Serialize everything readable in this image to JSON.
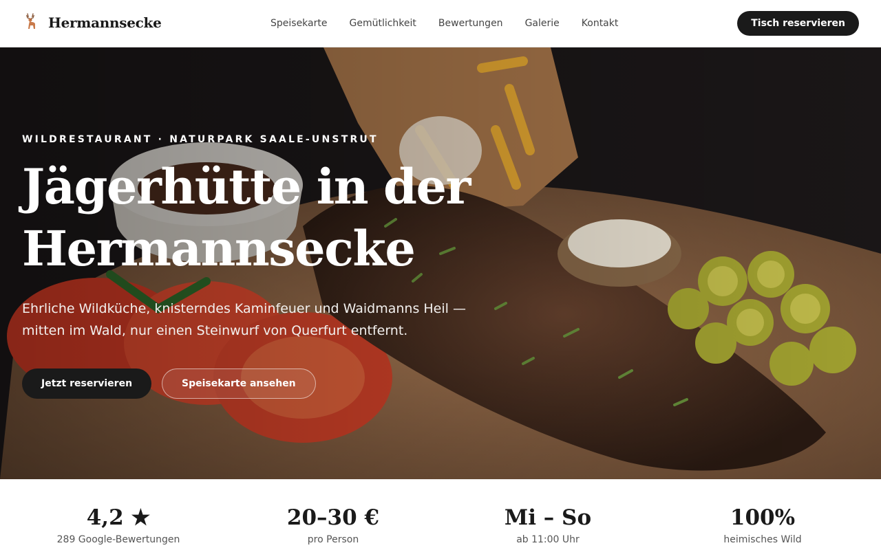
{
  "header": {
    "brand_name": "Hermannsecke",
    "brand_icon": "deer-icon",
    "nav": [
      "Speisekarte",
      "Gemütlichkeit",
      "Bewertungen",
      "Galerie",
      "Kontakt"
    ],
    "cta_label": "Tisch reservieren"
  },
  "hero": {
    "eyebrow": "WILDRESTAURANT · NATURPARK SAALE-UNSTRUT",
    "title": "Jägerhütte in der Hermannsecke",
    "subtitle": "Ehrliche Wildküche, knisterndes Kaminfeuer und Waidmanns Heil — mitten im Wald, nur einen Steinwurf von Querfurt entfernt.",
    "primary_button": "Jetzt reservieren",
    "secondary_button": "Speisekarte ansehen"
  },
  "stats": [
    {
      "value": "4,2 ★",
      "label": "289 Google-Bewertungen"
    },
    {
      "value": "20–30 €",
      "label": "pro Person"
    },
    {
      "value": "Mi – So",
      "label": "ab 11:00 Uhr"
    },
    {
      "value": "100%",
      "label": "heimisches Wild"
    }
  ],
  "colors": {
    "ink": "#1a1a1a",
    "background": "#ffffff",
    "hero_dark": "#1b1718"
  }
}
